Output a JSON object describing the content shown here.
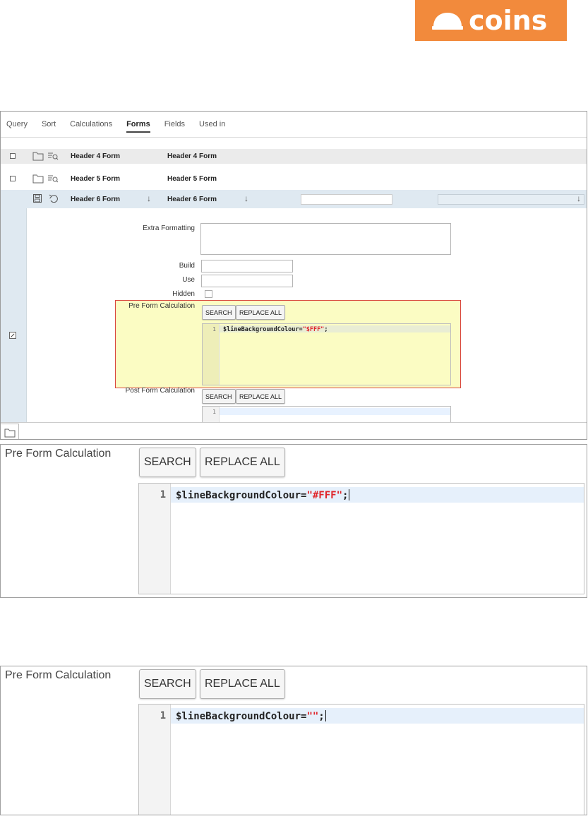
{
  "logo": {
    "text": "coins",
    "color": "#f28a3c"
  },
  "tabs": [
    {
      "label": "Query"
    },
    {
      "label": "Sort"
    },
    {
      "label": "Calculations"
    },
    {
      "label": "Forms",
      "active": true
    },
    {
      "label": "Fields"
    },
    {
      "label": "Used in"
    }
  ],
  "rows": [
    {
      "name": "Header 4 Form",
      "form": "Header 4 Form"
    },
    {
      "name": "Header 5 Form",
      "form": "Header 5 Form"
    },
    {
      "name": "Header 6 Form",
      "form": "Header 6 Form"
    }
  ],
  "form": {
    "extra_formatting_label": "Extra Formatting",
    "build_label": "Build",
    "use_label": "Use",
    "hidden_label": "Hidden",
    "pre_calc_label": "Pre Form Calculation",
    "post_calc_label": "Post Form Calculation",
    "search_label": "SEARCH",
    "replace_all_label": "REPLACE ALL"
  },
  "editor_small": {
    "line_number": "1",
    "code_prefix": "$lineBackgroundColour=",
    "code_string": "\"$FFF\"",
    "code_suffix": ";"
  },
  "editor_small_post": {
    "line_number": "1"
  },
  "zoom1": {
    "label": "Pre Form Calculation",
    "search_label": "SEARCH",
    "replace_all_label": "REPLACE ALL",
    "line_number": "1",
    "code_prefix": "$lineBackgroundColour=",
    "code_string": "\"#FFF\"",
    "code_suffix": ";"
  },
  "zoom2": {
    "label": "Pre Form Calculation",
    "search_label": "SEARCH",
    "replace_all_label": "REPLACE ALL",
    "line_number": "1",
    "code_prefix": "$lineBackgroundColour=",
    "code_string": "\"\"",
    "code_suffix": ";"
  },
  "colors": {
    "highlight_bg": "#fbfcc3",
    "highlight_border": "#d9473f",
    "row_selected": "#dfe9f1",
    "string": "#e0252a"
  }
}
